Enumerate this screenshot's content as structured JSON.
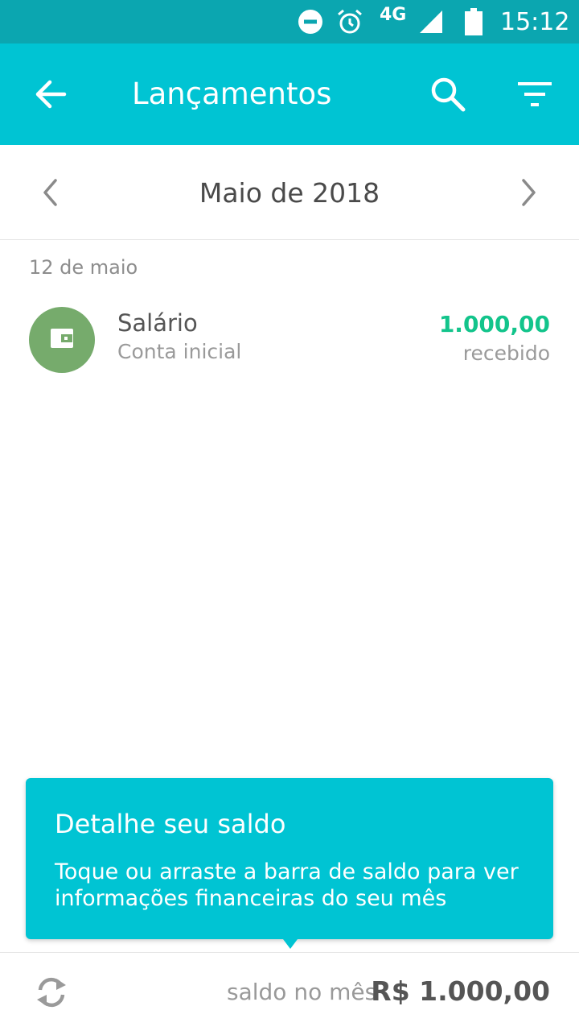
{
  "status_bar": {
    "network": "4G",
    "time": "15:12",
    "icons": [
      "do-not-disturb-icon",
      "alarm-icon",
      "signal-icon",
      "battery-icon"
    ]
  },
  "app_bar": {
    "title": "Lançamentos",
    "icons": [
      "back-arrow-icon",
      "search-icon",
      "filter-icon"
    ]
  },
  "month_nav": {
    "month_label": "Maio de 2018"
  },
  "transactions": [
    {
      "date_header": "12 de maio",
      "name": "Salário",
      "account": "Conta inicial",
      "amount": "1.000,00",
      "status": "recebido",
      "icon": "wallet-icon"
    }
  ],
  "tooltip": {
    "title": "Detalhe seu saldo",
    "body": "Toque ou arraste a barra de saldo para ver informações financeiras do seu mês"
  },
  "balance_bar": {
    "label": "saldo no mês",
    "value": "R$ 1.000,00"
  },
  "colors": {
    "status_bar": "#0ba6b0",
    "primary": "#00c4d3",
    "income_green": "#12c48b",
    "category_green": "#76ab6c"
  }
}
